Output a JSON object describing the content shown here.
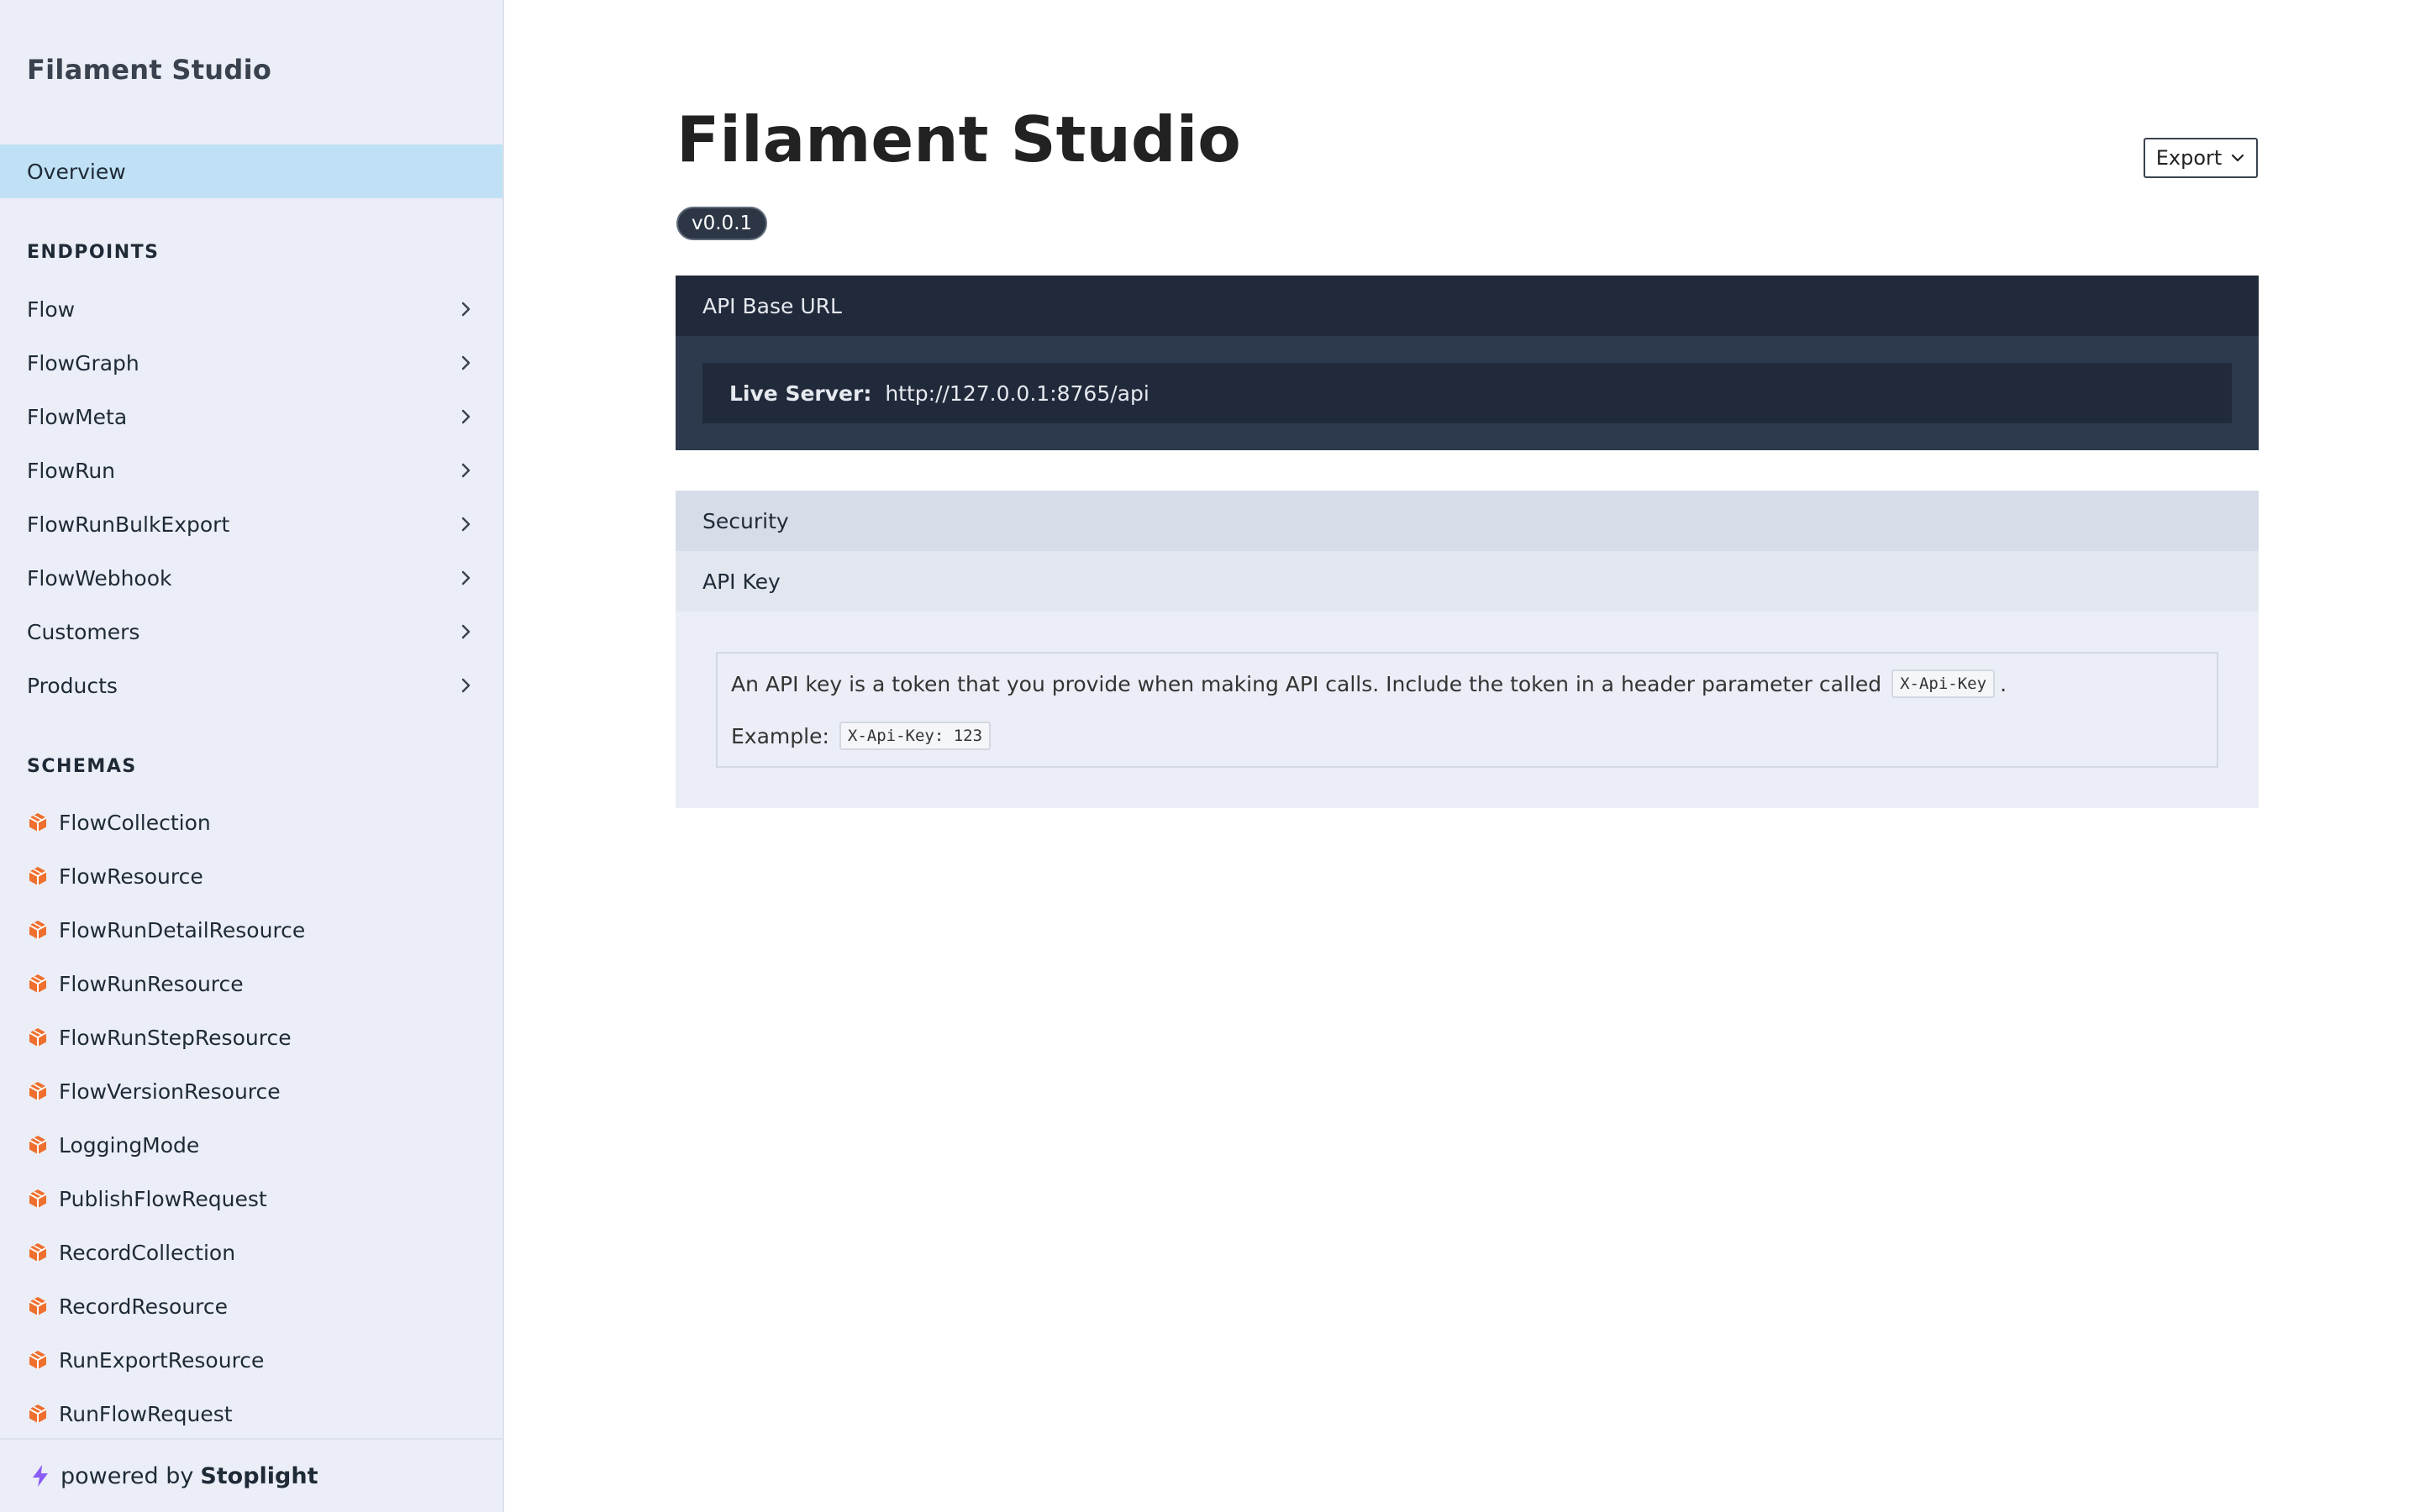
{
  "app": {
    "title": "Filament Studio"
  },
  "sidebar": {
    "brand": "Filament Studio",
    "overview_label": "Overview",
    "endpoints_title": "ENDPOINTS",
    "endpoints": [
      {
        "label": "Flow"
      },
      {
        "label": "FlowGraph"
      },
      {
        "label": "FlowMeta"
      },
      {
        "label": "FlowRun"
      },
      {
        "label": "FlowRunBulkExport"
      },
      {
        "label": "FlowWebhook"
      },
      {
        "label": "Customers"
      },
      {
        "label": "Products"
      }
    ],
    "schemas_title": "SCHEMAS",
    "schemas": [
      {
        "label": "FlowCollection",
        "icon": "cube-icon"
      },
      {
        "label": "FlowResource",
        "icon": "cube-icon"
      },
      {
        "label": "FlowRunDetailResource",
        "icon": "cube-icon"
      },
      {
        "label": "FlowRunResource",
        "icon": "cube-icon"
      },
      {
        "label": "FlowRunStepResource",
        "icon": "cube-icon"
      },
      {
        "label": "FlowVersionResource",
        "icon": "cube-icon"
      },
      {
        "label": "LoggingMode",
        "icon": "cube-icon"
      },
      {
        "label": "PublishFlowRequest",
        "icon": "cube-icon"
      },
      {
        "label": "RecordCollection",
        "icon": "cube-icon"
      },
      {
        "label": "RecordResource",
        "icon": "cube-icon"
      },
      {
        "label": "RunExportResource",
        "icon": "cube-icon"
      },
      {
        "label": "RunFlowRequest",
        "icon": "cube-icon"
      }
    ],
    "footer": {
      "prefix": "powered by",
      "brand": "Stoplight"
    }
  },
  "main": {
    "title": "Filament Studio",
    "version": "v0.0.1",
    "export_label": "Export",
    "api_base": {
      "header": "API Base URL",
      "server_label": "Live Server:",
      "server_url": "http://127.0.0.1:8765/api"
    },
    "security": {
      "header": "Security",
      "scheme_name": "API Key",
      "description": "An API key is a token that you provide when making API calls. Include the token in a header parameter called",
      "header_param": "X-Api-Key",
      "period": ".",
      "example_label": "Example:",
      "example_value": "X-Api-Key: 123"
    }
  },
  "colors": {
    "sidebar_bg": "#ebeef6",
    "active_nav": "#c0e1f5",
    "dark_panel": "#212a3a",
    "schema_icon": "#ef6f2e",
    "bolt_icon": "#8b5cf6"
  }
}
